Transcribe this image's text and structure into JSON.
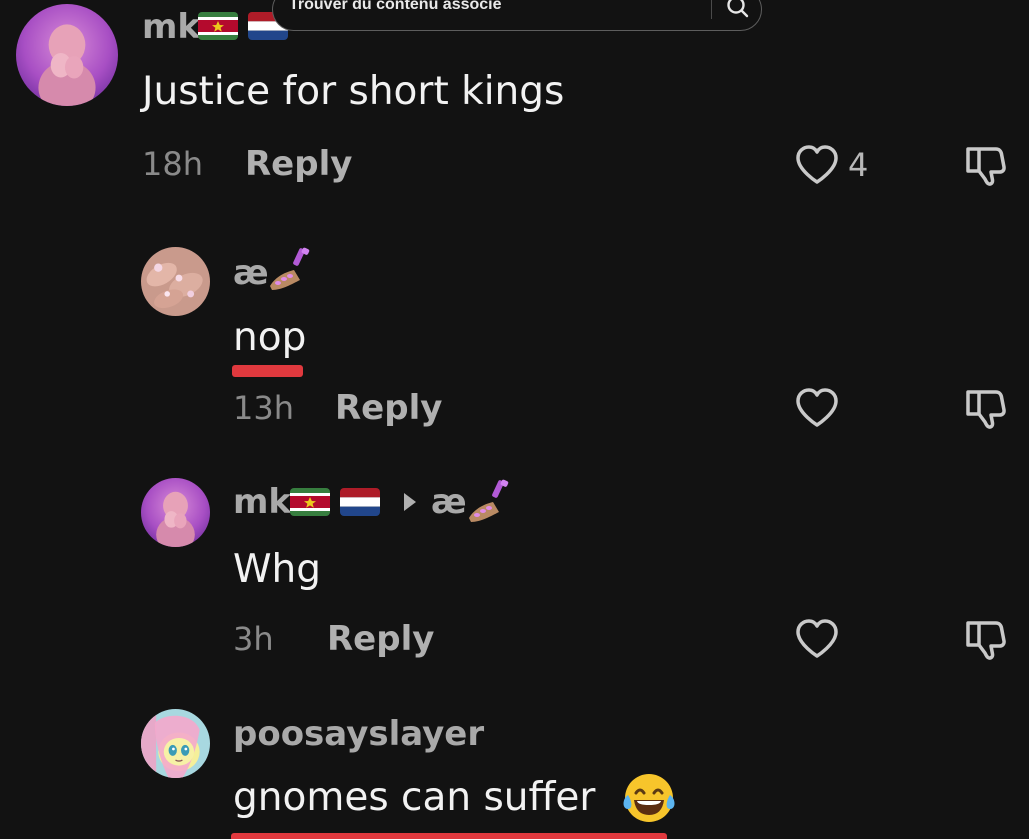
{
  "search": {
    "placeholder": "Trouver du contenu associé"
  },
  "comments": [
    {
      "username": "mk",
      "text": "Justice for short kings",
      "time": "18h",
      "reply_label": "Reply",
      "likes": "4",
      "flags": [
        "suriname-flag",
        "netherlands-flag"
      ]
    },
    {
      "username": "æ",
      "text": "nop",
      "time": "13h",
      "reply_label": "Reply",
      "emoji": "nail-polish-emoji"
    },
    {
      "username": "mk",
      "reply_to": "æ",
      "text": "Whg",
      "time": "3h",
      "reply_label": "Reply",
      "flags": [
        "suriname-flag",
        "netherlands-flag"
      ]
    },
    {
      "username": "poosayslayer",
      "text": "gnomes can suffer",
      "emoji": "laughing-tears-emoji"
    }
  ],
  "colors": {
    "background": "#121212",
    "username": "#a9a9a9",
    "comment_text": "#f2f2f2",
    "meta": "#8a8a8a",
    "underline_accent": "#e0393e"
  },
  "icons": [
    "heart-icon",
    "dislike-icon",
    "search-icon",
    "reply-arrow-icon"
  ]
}
